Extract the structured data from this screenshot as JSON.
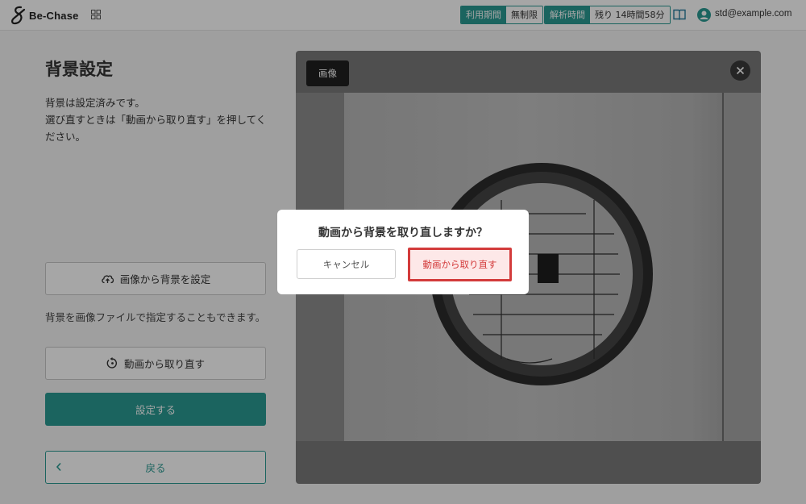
{
  "header": {
    "logo_text": "Be-Chase",
    "usage_period": {
      "label": "利用期間",
      "value": "無制限"
    },
    "analysis_time": {
      "label": "解析時間",
      "value": "残り 14時間58分"
    },
    "user_email": "std@example.com"
  },
  "left": {
    "title": "背景設定",
    "desc_line1": "背景は設定済みです。",
    "desc_line2": "選び直すときは「動画から取り直す」を押してください。",
    "set_from_image_label": "画像から背景を設定",
    "note": "背景を画像ファイルで指定することもできます。",
    "retake_from_video_label": "動画から取り直す",
    "submit_label": "設定する",
    "back_label": "戻る"
  },
  "preview": {
    "tab_label": "画像"
  },
  "dialog": {
    "title": "動画から背景を取り直しますか？",
    "cancel_label": "キャンセル",
    "confirm_label": "動画から取り直す"
  },
  "colors": {
    "accent": "#2a9a92",
    "danger": "#d33b3b"
  }
}
